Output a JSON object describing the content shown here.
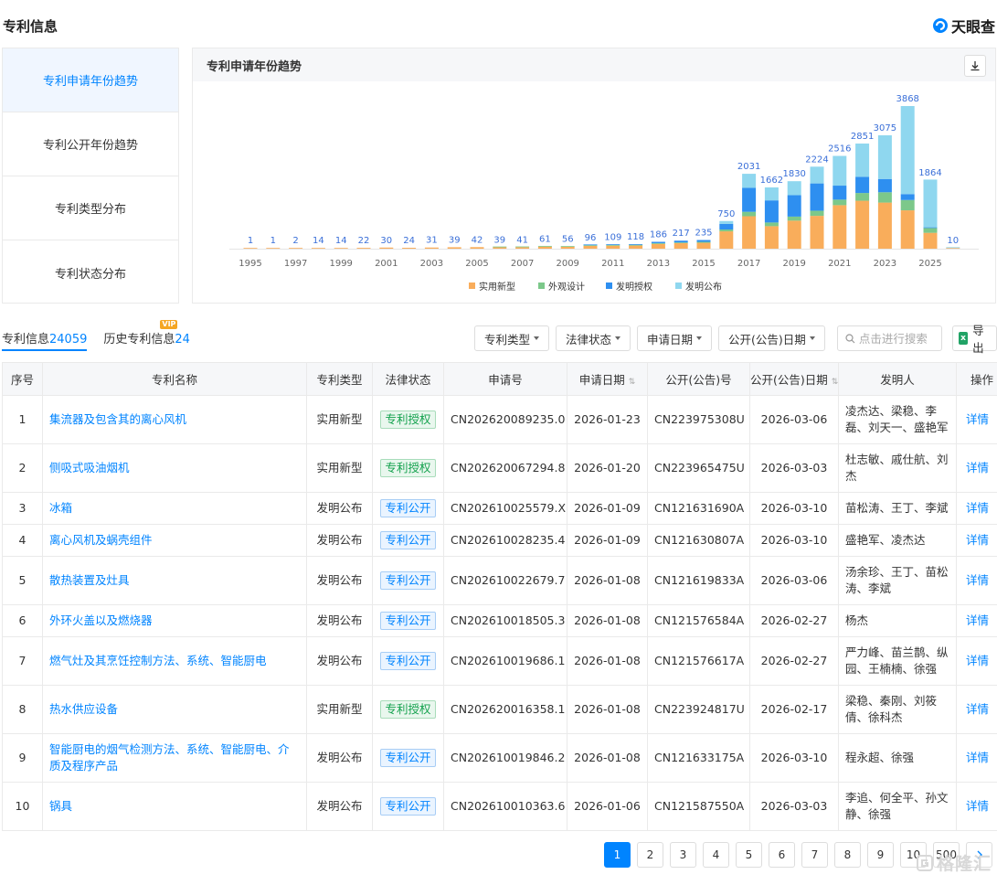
{
  "header": {
    "title": "专利信息",
    "brand": "天眼查"
  },
  "sidebar": {
    "items": [
      "专利申请年份趋势",
      "专利公开年份趋势",
      "专利类型分布",
      "专利状态分布"
    ]
  },
  "chart_panel": {
    "title": "专利申请年份趋势"
  },
  "chart_data": {
    "type": "bar",
    "stacked": true,
    "categories": [
      "1995",
      "1996",
      "1997",
      "1998",
      "1999",
      "2000",
      "2001",
      "2002",
      "2003",
      "2004",
      "2005",
      "2006",
      "2007",
      "2008",
      "2009",
      "2010",
      "2011",
      "2012",
      "2013",
      "2014",
      "2015",
      "2016",
      "2017",
      "2018",
      "2019",
      "2020",
      "2021",
      "2022",
      "2023",
      "2024",
      "2025",
      "2026"
    ],
    "x_tick_labels": [
      "1995",
      "1997",
      "1999",
      "2001",
      "2003",
      "2005",
      "2007",
      "2009",
      "2011",
      "2013",
      "2015",
      "2017",
      "2019",
      "2021",
      "2023",
      "2025"
    ],
    "totals": [
      1,
      1,
      2,
      14,
      14,
      22,
      30,
      24,
      31,
      39,
      42,
      39,
      41,
      61,
      56,
      96,
      109,
      118,
      186,
      217,
      235,
      750,
      2031,
      1662,
      1830,
      2224,
      2516,
      2851,
      3075,
      3868,
      1864,
      10
    ],
    "series": [
      {
        "name": "实用新型",
        "color": "#f9ad5b",
        "values": [
          1,
          1,
          2,
          14,
          14,
          22,
          30,
          24,
          31,
          39,
          42,
          38,
          40,
          55,
          50,
          75,
          82,
          85,
          130,
          150,
          160,
          470,
          880,
          610,
          760,
          890,
          1180,
          1300,
          1250,
          1040,
          430,
          8
        ]
      },
      {
        "name": "外观设计",
        "color": "#7cc88a",
        "values": [
          0,
          0,
          0,
          0,
          0,
          0,
          0,
          0,
          0,
          0,
          0,
          1,
          1,
          6,
          6,
          10,
          12,
          15,
          20,
          20,
          25,
          50,
          120,
          100,
          110,
          140,
          150,
          210,
          280,
          280,
          130,
          0
        ]
      },
      {
        "name": "发明授权",
        "color": "#2e8ff0",
        "values": [
          0,
          0,
          0,
          0,
          0,
          0,
          0,
          0,
          0,
          0,
          0,
          0,
          0,
          0,
          0,
          11,
          15,
          18,
          36,
          47,
          50,
          150,
          650,
          600,
          580,
          740,
          380,
          440,
          360,
          160,
          10,
          0
        ]
      },
      {
        "name": "发明公布",
        "color": "#8fd7ef",
        "values": [
          0,
          0,
          0,
          0,
          0,
          0,
          0,
          0,
          0,
          0,
          0,
          0,
          0,
          0,
          0,
          0,
          0,
          0,
          0,
          0,
          0,
          80,
          381,
          352,
          380,
          454,
          806,
          901,
          1185,
          2388,
          1294,
          2
        ]
      }
    ],
    "legend": "bottom",
    "grid": false
  },
  "tabs": [
    {
      "label": "专利信息",
      "count": "24059"
    },
    {
      "label": "历史专利信息",
      "count": "24",
      "badge": "VIP"
    }
  ],
  "filters": [
    "专利类型",
    "法律状态",
    "申请日期",
    "公开(公告)日期"
  ],
  "search": {
    "placeholder": "点击进行搜索"
  },
  "export_label": "导出",
  "table": {
    "headers": [
      "序号",
      "专利名称",
      "专利类型",
      "法律状态",
      "申请号",
      "申请日期",
      "公开(公告)号",
      "公开(公告)日期",
      "发明人",
      "操作"
    ],
    "action_label": "详情",
    "rows": [
      {
        "no": "1",
        "name": "集流器及包含其的离心风机",
        "type": "实用新型",
        "status": "专利授权",
        "app_no": "CN202620089235.0",
        "app_date": "2026-01-23",
        "pub_no": "CN223975308U",
        "pub_date": "2026-03-06",
        "inventors": "凌杰达、梁稳、李磊、刘天一、盛艳军"
      },
      {
        "no": "2",
        "name": "侧吸式吸油烟机",
        "type": "实用新型",
        "status": "专利授权",
        "app_no": "CN202620067294.8",
        "app_date": "2026-01-20",
        "pub_no": "CN223965475U",
        "pub_date": "2026-03-03",
        "inventors": "杜志敏、戚仕航、刘杰"
      },
      {
        "no": "3",
        "name": "冰箱",
        "type": "发明公布",
        "status": "专利公开",
        "app_no": "CN202610025579.X",
        "app_date": "2026-01-09",
        "pub_no": "CN121631690A",
        "pub_date": "2026-03-10",
        "inventors": "苗松涛、王丁、李斌"
      },
      {
        "no": "4",
        "name": "离心风机及蜗壳组件",
        "type": "发明公布",
        "status": "专利公开",
        "app_no": "CN202610028235.4",
        "app_date": "2026-01-09",
        "pub_no": "CN121630807A",
        "pub_date": "2026-03-10",
        "inventors": "盛艳军、凌杰达"
      },
      {
        "no": "5",
        "name": "散热装置及灶具",
        "type": "发明公布",
        "status": "专利公开",
        "app_no": "CN202610022679.7",
        "app_date": "2026-01-08",
        "pub_no": "CN121619833A",
        "pub_date": "2026-03-06",
        "inventors": "汤余珍、王丁、苗松涛、李斌"
      },
      {
        "no": "6",
        "name": "外环火盖以及燃烧器",
        "type": "发明公布",
        "status": "专利公开",
        "app_no": "CN202610018505.3",
        "app_date": "2026-01-08",
        "pub_no": "CN121576584A",
        "pub_date": "2026-02-27",
        "inventors": "杨杰"
      },
      {
        "no": "7",
        "name": "燃气灶及其烹饪控制方法、系统、智能厨电",
        "type": "发明公布",
        "status": "专利公开",
        "app_no": "CN202610019686.1",
        "app_date": "2026-01-08",
        "pub_no": "CN121576617A",
        "pub_date": "2026-02-27",
        "inventors": "严力峰、苗兰鹊、纵园、王楠楠、徐强"
      },
      {
        "no": "8",
        "name": "热水供应设备",
        "type": "实用新型",
        "status": "专利授权",
        "app_no": "CN202620016358.1",
        "app_date": "2026-01-08",
        "pub_no": "CN223924817U",
        "pub_date": "2026-02-17",
        "inventors": "梁稳、秦刚、刘筱倩、徐科杰"
      },
      {
        "no": "9",
        "name": "智能厨电的烟气检测方法、系统、智能厨电、介质及程序产品",
        "type": "发明公布",
        "status": "专利公开",
        "app_no": "CN202610019846.2",
        "app_date": "2026-01-08",
        "pub_no": "CN121633175A",
        "pub_date": "2026-03-10",
        "inventors": "程永超、徐强"
      },
      {
        "no": "10",
        "name": "锅具",
        "type": "发明公布",
        "status": "专利公开",
        "app_no": "CN202610010363.6",
        "app_date": "2026-01-06",
        "pub_no": "CN121587550A",
        "pub_date": "2026-03-03",
        "inventors": "李追、何全平、孙文静、徐强"
      }
    ]
  },
  "pagination": {
    "pages": [
      "1",
      "2",
      "3",
      "4",
      "5",
      "6",
      "7",
      "8",
      "9",
      "10",
      "500"
    ],
    "current": "1"
  },
  "watermark": "格隆汇"
}
